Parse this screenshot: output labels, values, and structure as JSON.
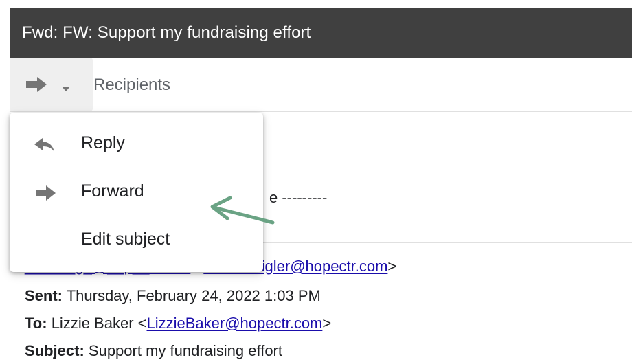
{
  "window": {
    "title": "Fwd: FW: Support my fundraising effort"
  },
  "recipients": {
    "placeholder": "Recipients"
  },
  "reply_menu": {
    "items": [
      {
        "label": "Reply",
        "icon": "reply-icon"
      },
      {
        "label": "Forward",
        "icon": "forward-icon"
      },
      {
        "label": "Edit subject",
        "icon": ""
      }
    ]
  },
  "body": {
    "forwarded_marker_visible": "e ---------",
    "from_link_partial": "______g_@__p__tr.com",
    "from_lt": " <",
    "from_email": "LauraHaigler@hopectr.com",
    "from_gt": ">",
    "sent_label": "Sent:",
    "sent_value": " Thursday, February 24, 2022 1:03 PM",
    "to_label": "To:",
    "to_name": " Lizzie Baker <",
    "to_email": "LizzieBaker@hopectr.com",
    "to_gt": ">",
    "subject_label": "Subject:",
    "subject_value": " Support my fundraising effort"
  },
  "colors": {
    "titlebar": "#404040",
    "link": "#1a0dab",
    "annotation": "#6aa384"
  }
}
